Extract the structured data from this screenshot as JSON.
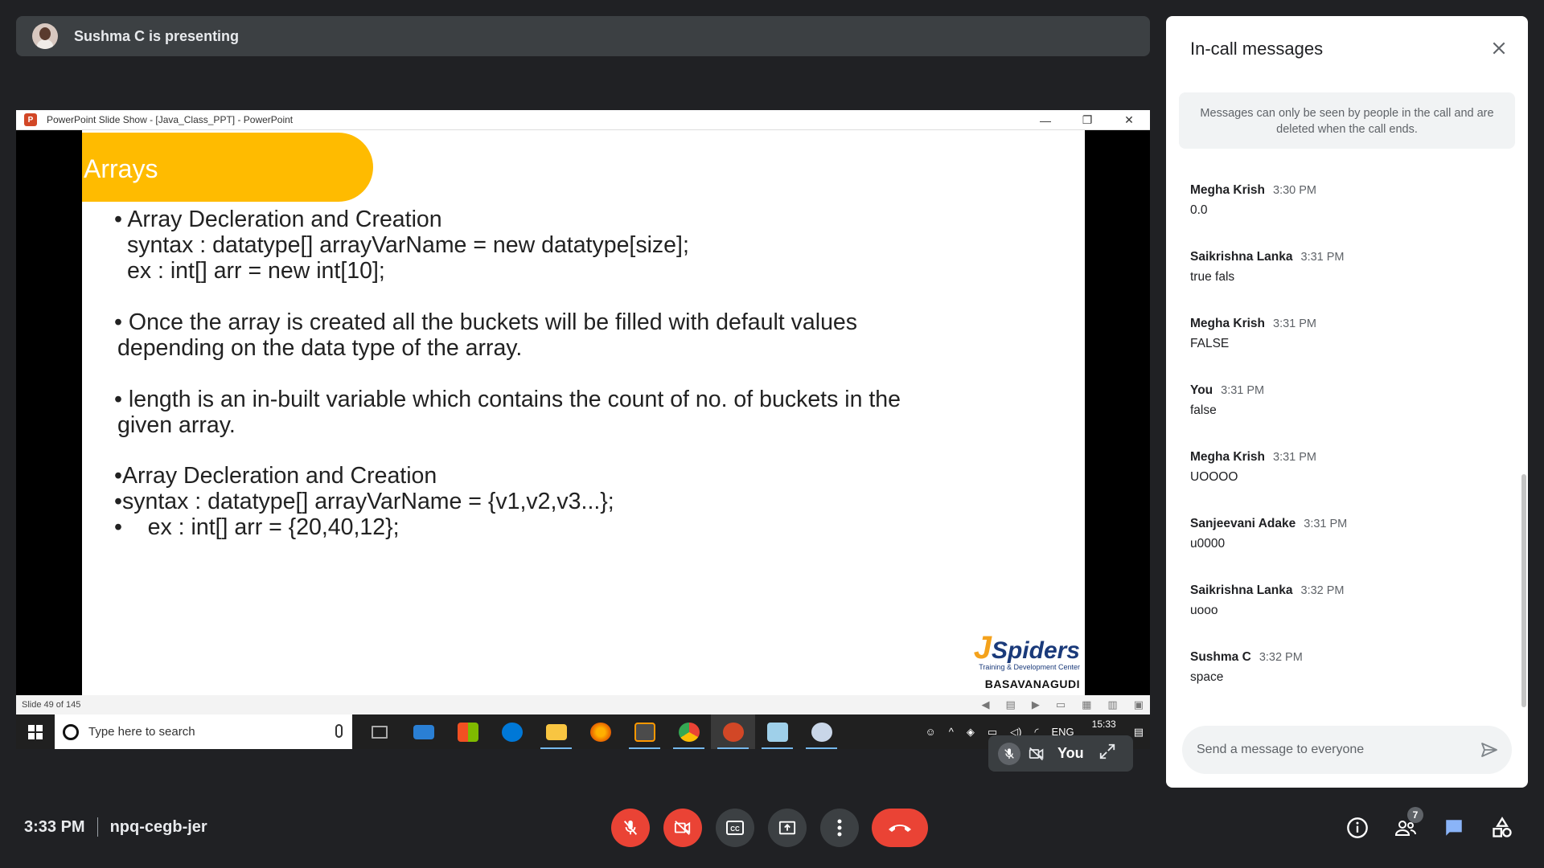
{
  "presenter": {
    "text": "Sushma C is presenting"
  },
  "powerpoint": {
    "window_title": "PowerPoint Slide Show - [Java_Class_PPT] - PowerPoint",
    "slide_counter": "Slide 49 of 145"
  },
  "slide": {
    "title": "Arrays",
    "lines": [
      "• Array Decleration and Creation",
      "syntax : datatype[] arrayVarName = new datatype[size];",
      "ex : int[] arr = new int[10];",
      "• Once the array is created all the buckets will be filled with default values",
      "depending on the data type of the array.",
      "• length is an in-built variable which contains the count of no. of buckets in the",
      "given array.",
      "•Array Decleration and Creation",
      "•syntax : datatype[] arrayVarName = {v1,v2,v3...};",
      "•    ex : int[] arr = {20,40,12};"
    ],
    "logo_main": "Spiders",
    "logo_letter": "J",
    "logo_sub": "Training & Development Center",
    "logo_branch": "BASAVANAGUDI"
  },
  "taskbar": {
    "search_placeholder": "Type here to search",
    "language": "ENG",
    "time": "15:33"
  },
  "self_tile": {
    "label": "You"
  },
  "chat": {
    "title": "In-call messages",
    "notice": "Messages can only be seen by people in the call and are deleted when the call ends.",
    "messages": [
      {
        "sender": "Megha Krish",
        "time": "3:30 PM",
        "text": "0.0"
      },
      {
        "sender": "Saikrishna Lanka",
        "time": "3:31 PM",
        "text": "true fals"
      },
      {
        "sender": "Megha Krish",
        "time": "3:31 PM",
        "text": "FALSE"
      },
      {
        "sender": "You",
        "time": "3:31 PM",
        "text": "false"
      },
      {
        "sender": "Megha Krish",
        "time": "3:31 PM",
        "text": "UOOOO"
      },
      {
        "sender": "Sanjeevani Adake",
        "time": "3:31 PM",
        "text": "u0000"
      },
      {
        "sender": "Saikrishna Lanka",
        "time": "3:32 PM",
        "text": "uooo"
      },
      {
        "sender": "Sushma C",
        "time": "3:32 PM",
        "text": "space"
      }
    ],
    "input_placeholder": "Send a message to everyone"
  },
  "bottom_bar": {
    "time": "3:33 PM",
    "meeting_code": "npq-cegb-jer",
    "participant_count": "7"
  },
  "colors": {
    "background": "#202124",
    "danger": "#ea4335",
    "accent": "#1a73e8",
    "slide_title_bg": "#ffbb00"
  }
}
